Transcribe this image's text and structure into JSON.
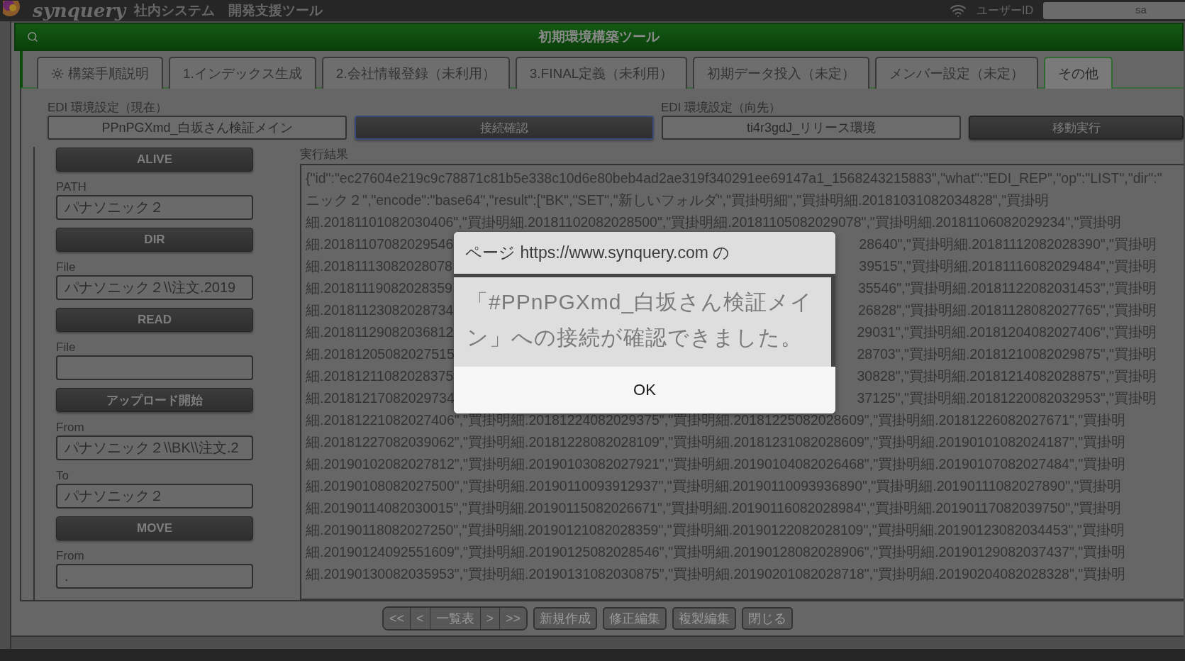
{
  "header": {
    "logo": "synquery",
    "subtitle": "社内システム　開発支援ツール",
    "user_label": "ユーザーID",
    "user_value": "sa"
  },
  "panel": {
    "title": "初期環境構築ツール"
  },
  "tabs": [
    {
      "label": "構築手順説明",
      "kind": "guide",
      "selected": false
    },
    {
      "label": "1.インデックス生成",
      "kind": "plain",
      "selected": false
    },
    {
      "label": "2.会社情報登録（未利用）",
      "kind": "plain",
      "selected": false
    },
    {
      "label": "3.FINAL定義（未利用）",
      "kind": "plain",
      "selected": false
    },
    {
      "label": "初期データ投入（未定）",
      "kind": "plain",
      "selected": false
    },
    {
      "label": "メンバー設定（未定）",
      "kind": "plain",
      "selected": false
    },
    {
      "label": "その他",
      "kind": "plain",
      "selected": true
    }
  ],
  "env": {
    "current_label": "EDI 環境設定（現在）",
    "current_value": "PPnPGXmd_白坂さん検証メイン",
    "check_button": "接続確認",
    "target_label": "EDI 環境設定（向先）",
    "target_value": "ti4r3gdJ_リリース環境",
    "move_button": "移動実行"
  },
  "left_controls": [
    {
      "kind": "button",
      "label": "ALIVE"
    },
    {
      "kind": "field",
      "label": "PATH",
      "value": "パナソニック２"
    },
    {
      "kind": "button",
      "label": "DIR"
    },
    {
      "kind": "field",
      "label": "File",
      "value": "パナソニック２\\\\注文.2019"
    },
    {
      "kind": "button",
      "label": "READ"
    },
    {
      "kind": "field",
      "label": "File"
    },
    {
      "kind": "button",
      "label": "アップロード開始"
    },
    {
      "kind": "field",
      "label": "From",
      "value": "パナソニック２\\\\BK\\\\注文.2"
    },
    {
      "kind": "field",
      "label": "To",
      "value": "パナソニック２"
    },
    {
      "kind": "button",
      "label": "MOVE"
    },
    {
      "kind": "field",
      "label": "From",
      "value": "."
    }
  ],
  "result": {
    "label": "実行結果",
    "lines": [
      {
        "text": "{\"id\":\"ec27604e219c9c78871c81b5e338c10d6e80beb4ad2ae319f340291ee69147a1_1568243215883\",\"what\":\"EDI_REP\",\"op\":\"LIST\",\"dir\":\""
      },
      {
        "text": "ニック２\",\"encode\":\"base64\",\"result\":[\"BK\",\"SET\",\"新しいフォルダ\",\"買掛明細\",\"買掛明細.20181031082034828\",\"買掛明"
      },
      {
        "text": "細.20181101082030406\",\"買掛明細.20181102082028500\",\"買掛明細.20181105082029078\",\"買掛明細.20181106082029234\",\"買掛明"
      },
      {
        "left": "細.20181107082029546",
        "right": "28640\",\"買掛明細.20181112082028390\",\"買掛明"
      },
      {
        "left": "細.20181113082028078",
        "right": "39515\",\"買掛明細.20181116082029484\",\"買掛明"
      },
      {
        "left": "細.20181119082028359",
        "right": "35546\",\"買掛明細.20181122082031453\",\"買掛明"
      },
      {
        "left": "細.20181123082028734",
        "right": "26828\",\"買掛明細.20181128082027765\",\"買掛明"
      },
      {
        "left": "細.20181129082036812",
        "right": "29031\",\"買掛明細.20181204082027406\",\"買掛明"
      },
      {
        "left": "細.20181205082027515",
        "right": "28703\",\"買掛明細.20181210082029875\",\"買掛明"
      },
      {
        "left": "細.20181211082028375",
        "right": "30828\",\"買掛明細.20181214082028875\",\"買掛明"
      },
      {
        "left": "細.20181217082029734",
        "right": "37125\",\"買掛明細.20181220082032953\",\"買掛明"
      },
      {
        "text": "細.20181221082027406\",\"買掛明細.20181224082029375\",\"買掛明細.20181225082028609\",\"買掛明細.20181226082027671\",\"買掛明"
      },
      {
        "text": "細.20181227082039062\",\"買掛明細.20181228082028109\",\"買掛明細.20181231082028609\",\"買掛明細.20190101082024187\",\"買掛明"
      },
      {
        "text": "細.20190102082027812\",\"買掛明細.20190103082027921\",\"買掛明細.20190104082026468\",\"買掛明細.20190107082027484\",\"買掛明"
      },
      {
        "text": "細.20190108082027500\",\"買掛明細.20190110093912937\",\"買掛明細.20190110093936890\",\"買掛明細.20190111082027890\",\"買掛明"
      },
      {
        "text": "細.20190114082030015\",\"買掛明細.20190115082026671\",\"買掛明細.20190116082028984\",\"買掛明細.20190117082039750\",\"買掛明"
      },
      {
        "text": "細.20190118082027250\",\"買掛明細.20190121082028359\",\"買掛明細.20190122082028109\",\"買掛明細.20190123082034453\",\"買掛明"
      },
      {
        "text": "細.20190124092551609\",\"買掛明細.20190125082028546\",\"買掛明細.20190128082028906\",\"買掛明細.20190129082037437\",\"買掛明"
      },
      {
        "text": "細.20190130082035953\",\"買掛明細.20190131082030875\",\"買掛明細.20190201082028718\",\"買掛明細.20190204082028328\",\"買掛明"
      }
    ]
  },
  "nav_buttons": [
    "<<",
    "<",
    "一覧表",
    ">",
    ">>"
  ],
  "action_buttons": [
    "新規作成",
    "修正編集",
    "複製編集",
    "閉じる"
  ],
  "dialog": {
    "title": "ページ https://www.synquery.com の",
    "message": "「#PPnPGXmd_白坂さん検証メイン」への接続が確認できました。",
    "ok": "OK"
  }
}
